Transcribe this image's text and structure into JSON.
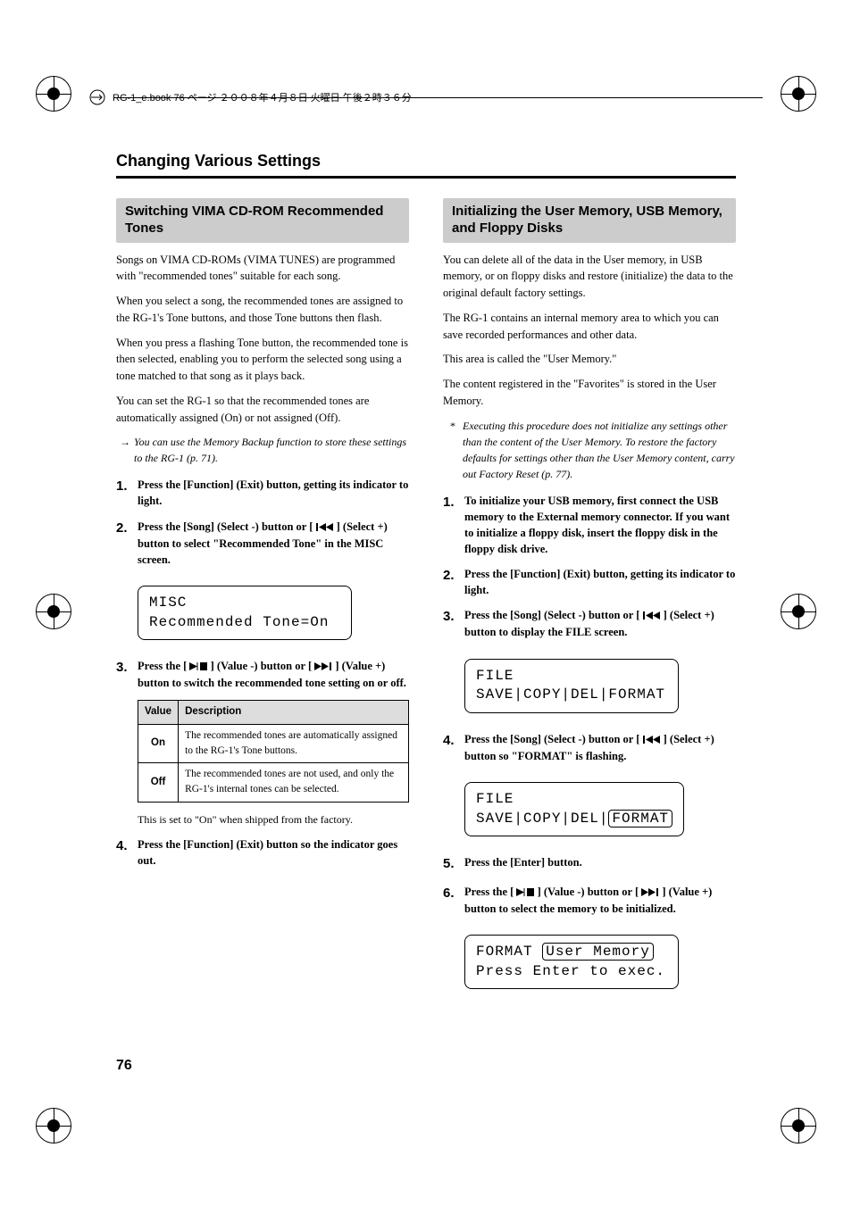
{
  "header": {
    "book_info": "RG-1_e.book 76 ページ ２００８年４月８日 火曜日 午後２時３６分"
  },
  "section_title": "Changing Various Settings",
  "left": {
    "heading": "Switching VIMA CD-ROM Recommended Tones",
    "p1": "Songs on VIMA CD-ROMs (VIMA TUNES) are programmed with \"recommended tones\" suitable for each song.",
    "p2": "When you select a song, the recommended tones are assigned to the RG-1's Tone buttons, and those Tone buttons then flash.",
    "p3": "When you press a flashing Tone button, the recommended tone is then selected, enabling you to perform the selected song using a tone matched to that song as it plays back.",
    "p4": "You can set the RG-1 so that the recommended tones are automatically assigned (On) or not assigned (Off).",
    "note1": "You can use the Memory Backup function to store these settings to the RG-1 (p. 71).",
    "step1": "Press the [Function] (Exit) button, getting its indicator to light.",
    "step2a": "Press the [Song] (Select -) button or [ ",
    "step2b": " ] (Select +) button to select \"Recommended Tone\" in the MISC screen.",
    "lcd1_l1": "MISC",
    "lcd1_l2": "Recommended Tone=On",
    "step3a": "Press the [ ",
    "step3b": " ] (Value -) button or [ ",
    "step3c": " ] (Value +) button to switch the recommended tone setting on or off.",
    "table": {
      "h1": "Value",
      "h2": "Description",
      "r1v": "On",
      "r1d": "The recommended tones are automatically assigned to the RG-1's Tone buttons.",
      "r2v": "Off",
      "r2d": "The recommended tones are not used, and only the RG-1's internal tones can be selected."
    },
    "factory_note": "This is set to \"On\" when shipped from the factory.",
    "step4": "Press the [Function] (Exit) button so the indicator goes out."
  },
  "right": {
    "heading": "Initializing the User Memory, USB Memory, and Floppy Disks",
    "p1": "You can delete all of the data in the User memory, in USB memory, or on floppy disks and restore (initialize) the data to the original default factory settings.",
    "p2": "The RG-1 contains an internal memory area to which you can save recorded performances and other data.",
    "p3": "This area is called the \"User Memory.\"",
    "p4": "The content registered in the \"Favorites\" is stored in the User Memory.",
    "note1": "Executing this procedure does not initialize any settings other than the content of the User Memory. To restore the factory defaults for settings other than the User Memory content, carry out Factory Reset (p. 77).",
    "step1": "To initialize your USB memory, first connect the USB memory to the External memory connector. If you want to initialize a floppy disk, insert the floppy disk in the floppy disk drive.",
    "step2": "Press the [Function] (Exit) button, getting its indicator to light.",
    "step3a": "Press the [Song] (Select -) button or [ ",
    "step3b": " ] (Select +) button to display the FILE screen.",
    "lcd1_l1": "FILE",
    "lcd1_l2": "SAVE|COPY|DEL|FORMAT",
    "step4a": "Press the [Song] (Select -) button or [ ",
    "step4b": " ] (Select +) button so \"FORMAT\" is flashing.",
    "lcd2_l1": "FILE",
    "lcd2_l2a": "SAVE|COPY|DEL|",
    "lcd2_l2b": "FORMAT",
    "step5": "Press the [Enter] button.",
    "step6a": "Press the [ ",
    "step6b": " ] (Value -) button or [ ",
    "step6c": " ] (Value +) button to select the memory to be initialized.",
    "lcd3_l1a": "FORMAT  ",
    "lcd3_l1b": "User Memory",
    "lcd3_l2": "Press Enter to exec."
  },
  "page_number": "76"
}
